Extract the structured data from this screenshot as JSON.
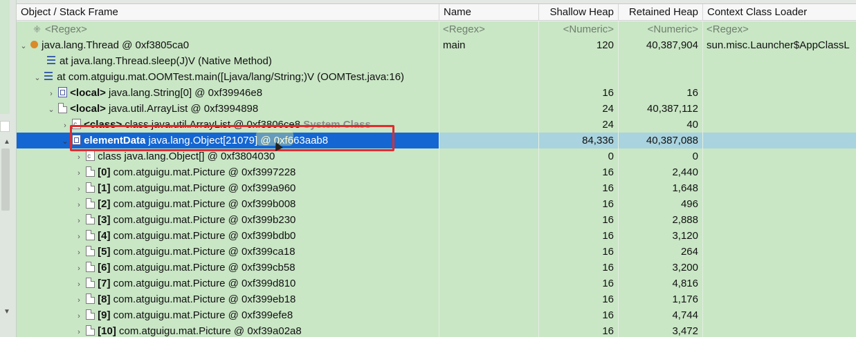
{
  "columns": {
    "object": "Object / Stack Frame",
    "name": "Name",
    "shallow": "Shallow Heap",
    "retained": "Retained Heap",
    "loader": "Context Class Loader"
  },
  "regex_row": {
    "object": "<Regex>",
    "name": "<Regex>",
    "shallow": "<Numeric>",
    "retained": "<Numeric>",
    "loader": "<Regex>"
  },
  "rows": [
    {
      "pre": "",
      "bold": "",
      "text": "java.lang.Thread @ 0xf3805ca0",
      "name": "main",
      "shallow": "120",
      "retained": "40,387,904",
      "loader": "sun.misc.Launcher$AppClassL",
      "suffix": ""
    },
    {
      "pre": "",
      "bold": "",
      "text": "at java.lang.Thread.sleep(J)V (Native Method)",
      "name": "",
      "shallow": "",
      "retained": "",
      "loader": "",
      "suffix": ""
    },
    {
      "pre": "",
      "bold": "",
      "text": "at com.atguigu.mat.OOMTest.main([Ljava/lang/String;)V (OOMTest.java:16)",
      "name": "",
      "shallow": "",
      "retained": "",
      "loader": "",
      "suffix": ""
    },
    {
      "pre": "",
      "bold": "<local>",
      "text": " java.lang.String[0] @ 0xf39946e8",
      "name": "",
      "shallow": "16",
      "retained": "16",
      "loader": "",
      "suffix": ""
    },
    {
      "pre": "",
      "bold": "<local>",
      "text": " java.util.ArrayList @ 0xf3994898",
      "name": "",
      "shallow": "24",
      "retained": "40,387,112",
      "loader": "",
      "suffix": ""
    },
    {
      "pre": "",
      "bold": "<class>",
      "text": " class java.util.ArrayList @ 0xf3806ce8",
      "name": "",
      "shallow": "24",
      "retained": "40",
      "loader": "",
      "suffix": " System Class"
    },
    {
      "pre": "",
      "bold": "elementData",
      "text": " java.lang.Object[21079] @ 0xf663aab8",
      "name": "",
      "shallow": "84,336",
      "retained": "40,387,088",
      "loader": "",
      "suffix": ""
    },
    {
      "pre": "",
      "bold": "",
      "text": "class java.lang.Object[] @ 0xf3804030",
      "name": "",
      "shallow": "0",
      "retained": "0",
      "loader": "",
      "suffix": ""
    },
    {
      "pre": "",
      "bold": "[0]",
      "text": " com.atguigu.mat.Picture @ 0xf3997228",
      "name": "",
      "shallow": "16",
      "retained": "2,440",
      "loader": "",
      "suffix": ""
    },
    {
      "pre": "",
      "bold": "[1]",
      "text": " com.atguigu.mat.Picture @ 0xf399a960",
      "name": "",
      "shallow": "16",
      "retained": "1,648",
      "loader": "",
      "suffix": ""
    },
    {
      "pre": "",
      "bold": "[2]",
      "text": " com.atguigu.mat.Picture @ 0xf399b008",
      "name": "",
      "shallow": "16",
      "retained": "496",
      "loader": "",
      "suffix": ""
    },
    {
      "pre": "",
      "bold": "[3]",
      "text": " com.atguigu.mat.Picture @ 0xf399b230",
      "name": "",
      "shallow": "16",
      "retained": "2,888",
      "loader": "",
      "suffix": ""
    },
    {
      "pre": "",
      "bold": "[4]",
      "text": " com.atguigu.mat.Picture @ 0xf399bdb0",
      "name": "",
      "shallow": "16",
      "retained": "3,120",
      "loader": "",
      "suffix": ""
    },
    {
      "pre": "",
      "bold": "[5]",
      "text": " com.atguigu.mat.Picture @ 0xf399ca18",
      "name": "",
      "shallow": "16",
      "retained": "264",
      "loader": "",
      "suffix": ""
    },
    {
      "pre": "",
      "bold": "[6]",
      "text": " com.atguigu.mat.Picture @ 0xf399cb58",
      "name": "",
      "shallow": "16",
      "retained": "3,200",
      "loader": "",
      "suffix": ""
    },
    {
      "pre": "",
      "bold": "[7]",
      "text": " com.atguigu.mat.Picture @ 0xf399d810",
      "name": "",
      "shallow": "16",
      "retained": "4,816",
      "loader": "",
      "suffix": ""
    },
    {
      "pre": "",
      "bold": "[8]",
      "text": " com.atguigu.mat.Picture @ 0xf399eb18",
      "name": "",
      "shallow": "16",
      "retained": "1,176",
      "loader": "",
      "suffix": ""
    },
    {
      "pre": "",
      "bold": "[9]",
      "text": " com.atguigu.mat.Picture @ 0xf399efe8",
      "name": "",
      "shallow": "16",
      "retained": "4,744",
      "loader": "",
      "suffix": ""
    },
    {
      "pre": "",
      "bold": "[10]",
      "text": " com.atguigu.mat.Picture @ 0xf39a02a8",
      "name": "",
      "shallow": "16",
      "retained": "3,472",
      "loader": "",
      "suffix": ""
    }
  ],
  "colors": {
    "row_bg": "#c9e6c5",
    "selection": "#1466d2",
    "highlight_box": "#e32b2b"
  },
  "icons": {
    "thread": "thread-icon",
    "frame": "stack-frame-icon",
    "object": "object-instance-icon",
    "array": "array-icon",
    "class": "class-icon"
  }
}
